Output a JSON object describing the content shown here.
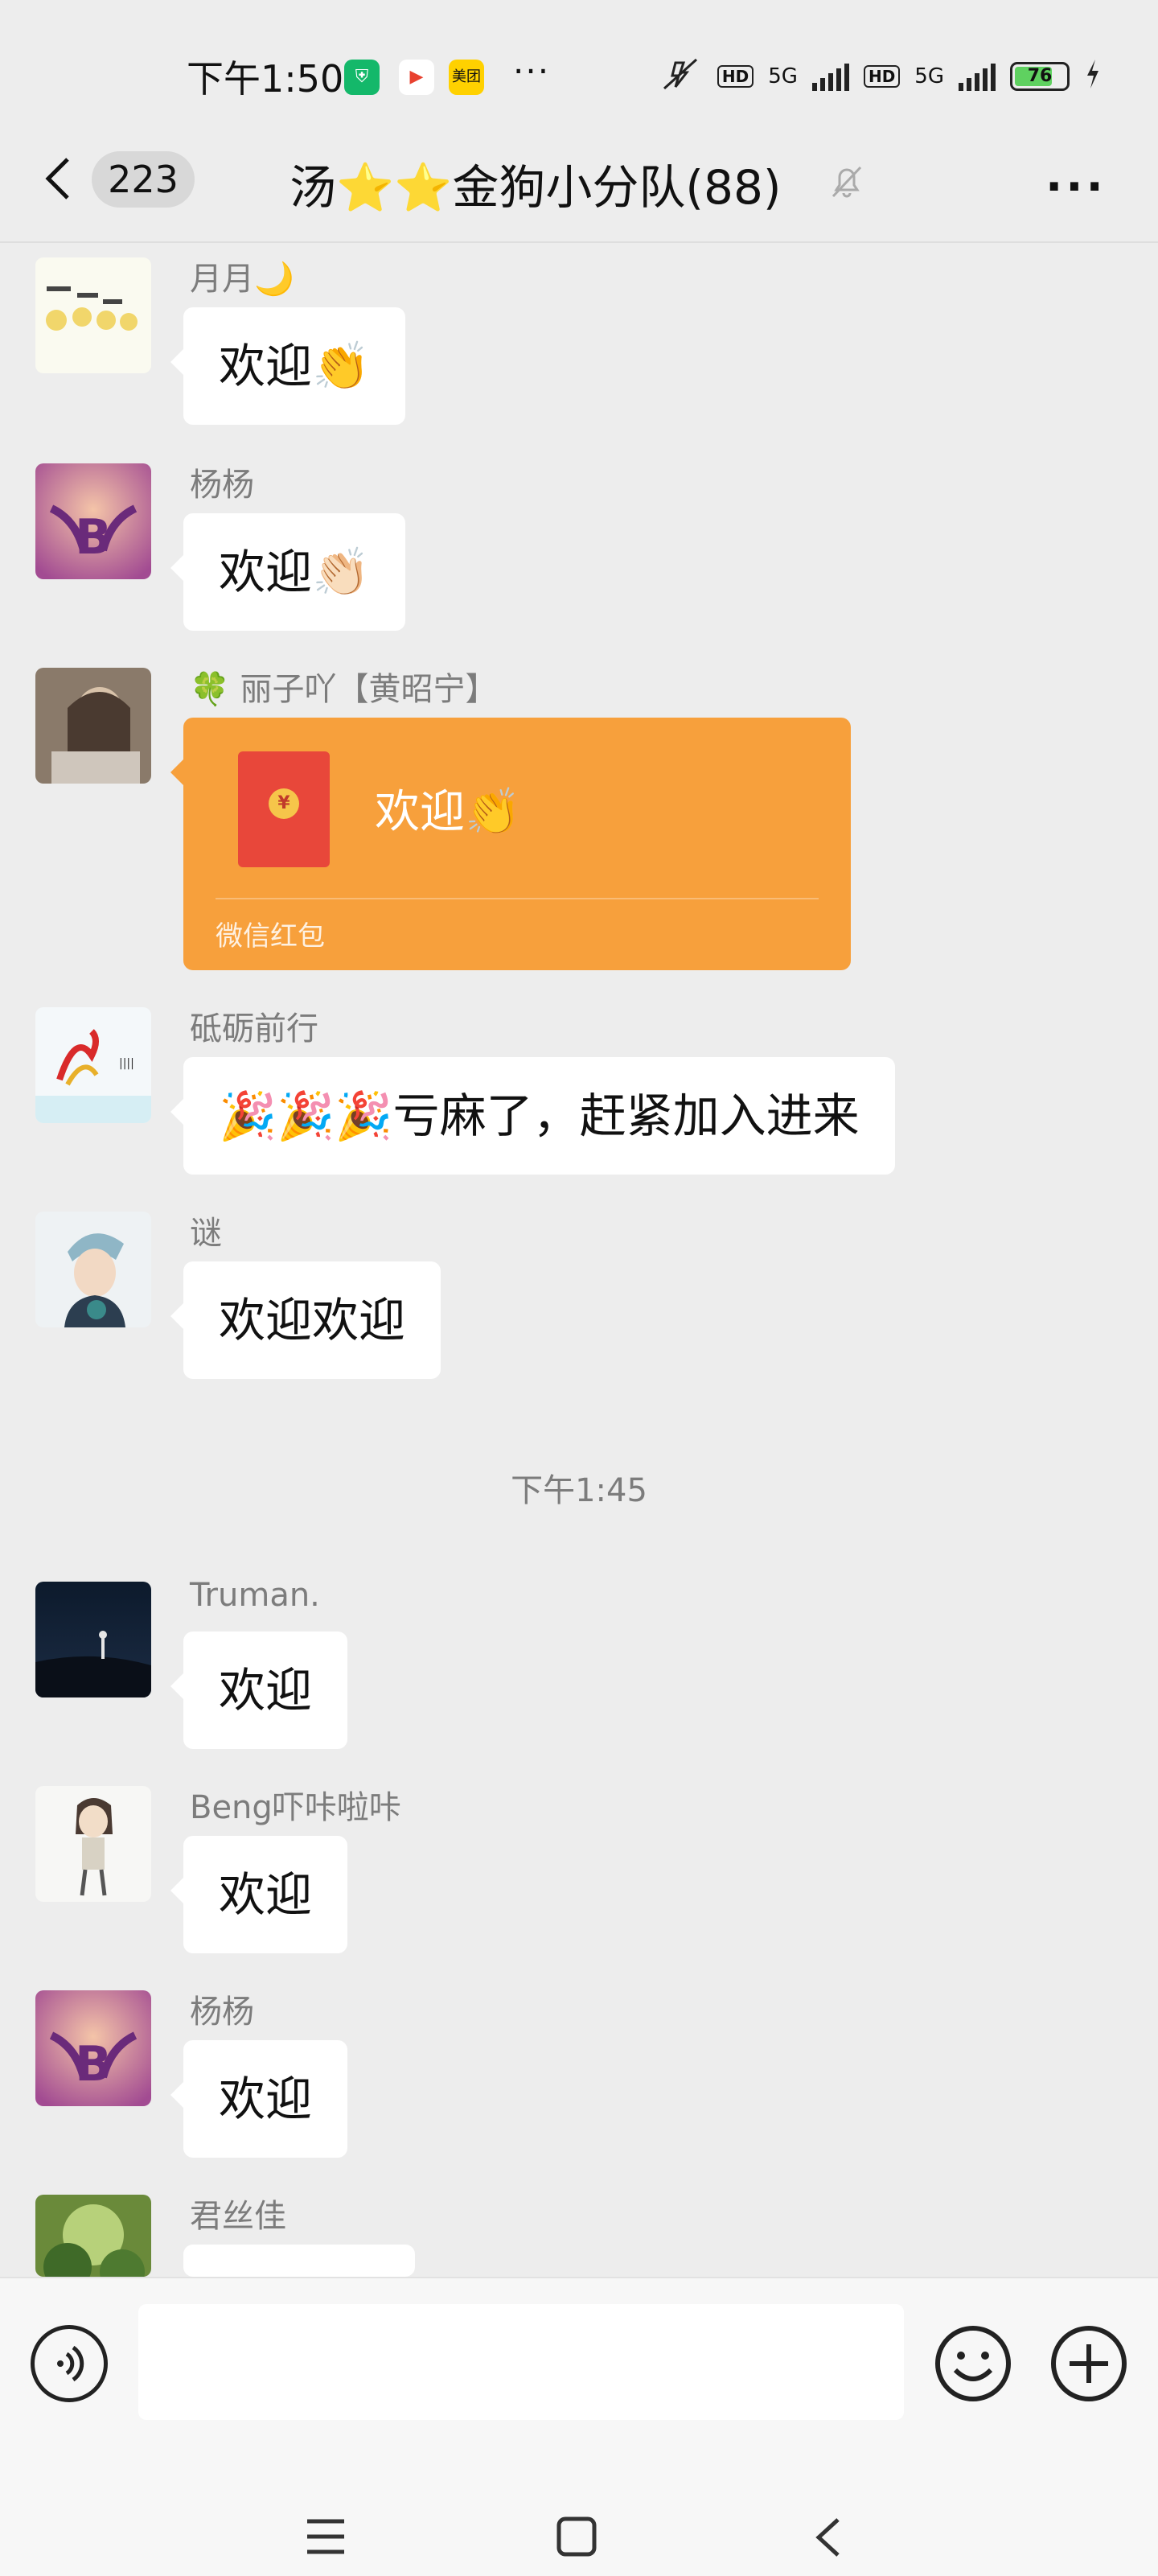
{
  "status_bar": {
    "time": "下午1:50",
    "app_icons": [
      "shield-app-icon",
      "play-app-icon",
      "meituan-app-icon"
    ],
    "meituan_label": "美团",
    "more": "···",
    "hd1": "HD",
    "net1": "5G",
    "hd2": "HD",
    "net2": "5G",
    "battery": "76"
  },
  "header": {
    "unread_count": "223",
    "title": "汤⭐⭐金狗小分队(88)",
    "more": "···"
  },
  "messages": [
    {
      "name": "月月🌙",
      "text": "欢迎👏"
    },
    {
      "name": "杨杨",
      "text": "欢迎👏🏻"
    },
    {
      "name": "🍀 丽子吖【黄昭宁】",
      "red_packet": {
        "text": "欢迎👏",
        "label": "微信红包",
        "coin": "¥"
      }
    },
    {
      "name": "砥砺前行",
      "text": "🎉🎉🎉亏麻了，赶紧加入进来"
    },
    {
      "name": "谜",
      "text": "欢迎欢迎"
    },
    {
      "name": "Truman.",
      "text": "欢迎"
    },
    {
      "name": "Beng吓咔啦咔",
      "text": "欢迎"
    },
    {
      "name": "杨杨",
      "text": "欢迎"
    },
    {
      "name": "君丝佳",
      "text": ""
    }
  ],
  "timestamp": "下午1:45",
  "input": {
    "value": "",
    "placeholder": ""
  },
  "colors": {
    "background": "#ededed",
    "bubble": "#ffffff",
    "red_packet": "#f7a03c",
    "name": "#7c7c7c"
  }
}
